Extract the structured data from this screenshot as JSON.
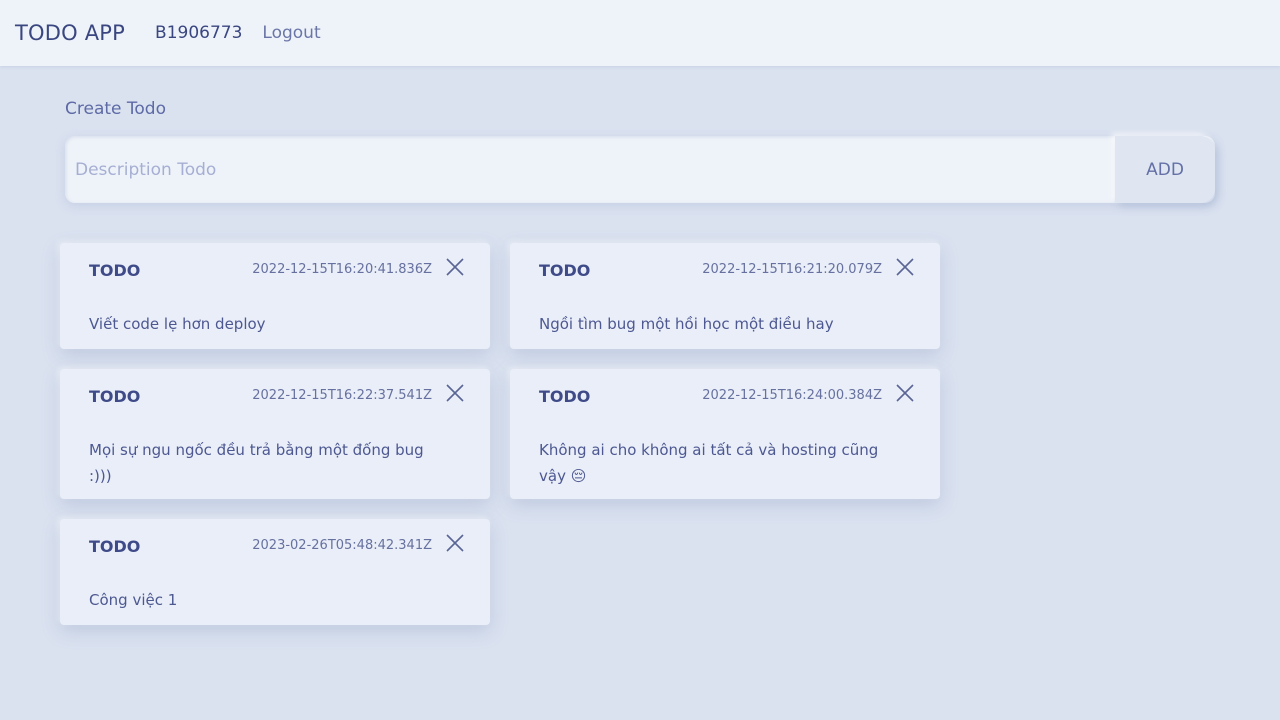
{
  "navbar": {
    "brand": "TODO APP",
    "user": "B1906773",
    "logout": "Logout"
  },
  "create": {
    "label": "Create Todo",
    "placeholder": "Description Todo",
    "add_label": "ADD"
  },
  "todos": [
    {
      "title": "TODO",
      "date": "2022-12-15T16:20:41.836Z",
      "description": "Viết code lẹ hơn deploy",
      "close_icon": "close-icon"
    },
    {
      "title": "TODO",
      "date": "2022-12-15T16:21:20.079Z",
      "description": "Ngồi tìm bug một hồi học một điều hay",
      "close_icon": "close-icon"
    },
    {
      "title": "TODO",
      "date": "2022-12-15T16:22:37.541Z",
      "description": "Mọi sự ngu ngốc đều trả bằng một đống bug :)))",
      "close_icon": "close-icon"
    },
    {
      "title": "TODO",
      "date": "2022-12-15T16:24:00.384Z",
      "description": "Không ai cho không ai tất cả và hosting cũng vậy 😔",
      "close_icon": "close-icon"
    },
    {
      "title": "TODO",
      "date": "2023-02-26T05:48:42.341Z",
      "description": "Công việc 1",
      "close_icon": "close-icon"
    }
  ],
  "colors": {
    "background": "#dae2f0",
    "navbar": "#eef3f9",
    "card": "#e9eef8",
    "text": "#3e4a82"
  }
}
